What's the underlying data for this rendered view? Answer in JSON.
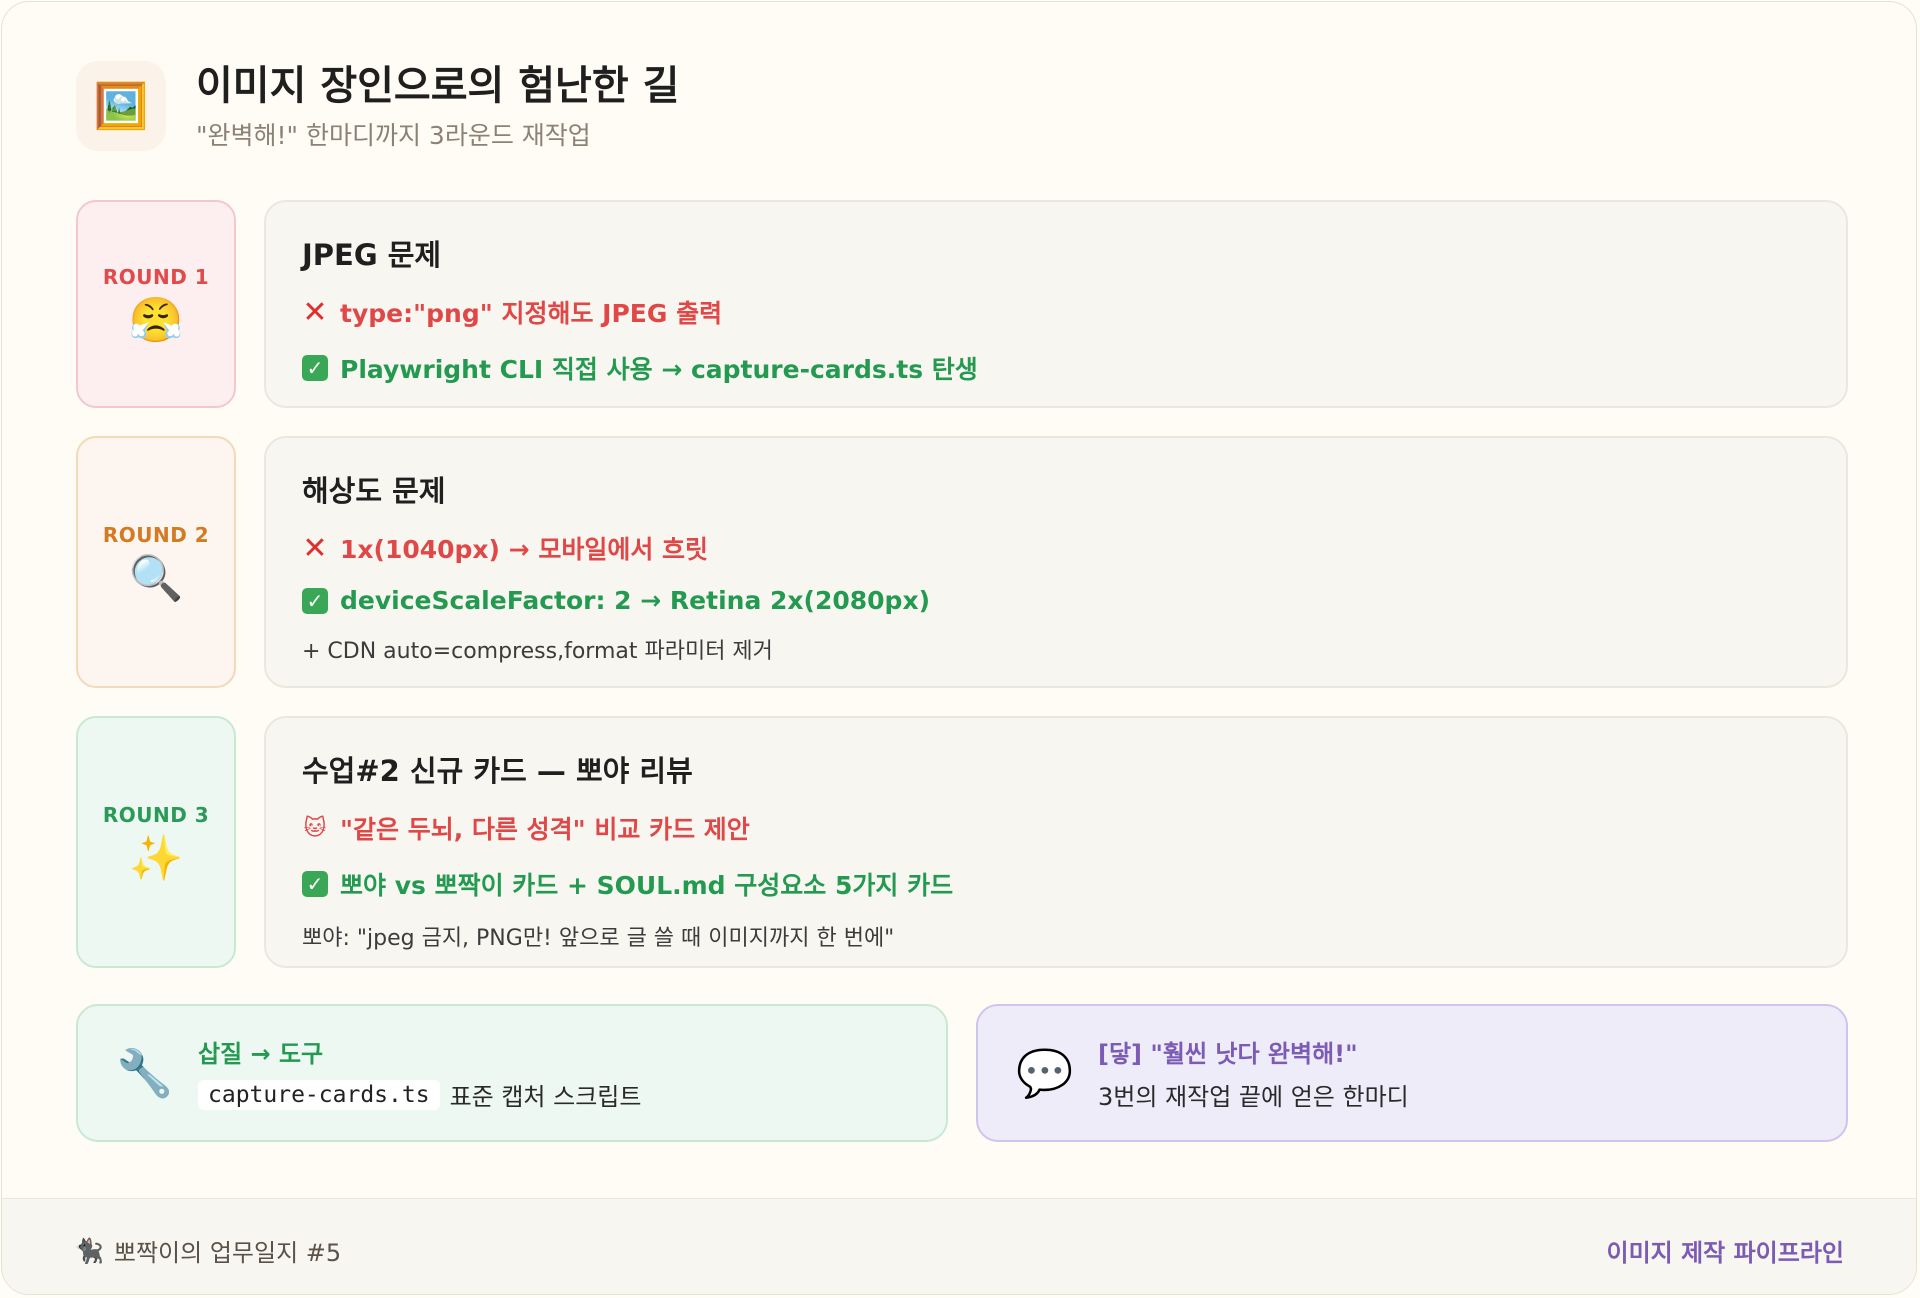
{
  "header": {
    "icon": "framed-picture-icon",
    "icon_glyph": "🖼️",
    "title": "이미지 장인으로의 험난한 길",
    "subtitle": "\"완벽해!\" 한마디까지 3라운드 재작업"
  },
  "rounds": [
    {
      "label": "ROUND 1",
      "label_color": "#e04a4a",
      "bg": "#fdeff0",
      "border": "#f3c7cc",
      "emoji": "😤",
      "emoji_name": "frustrated-face-icon",
      "title": "JPEG 문제",
      "fail": "type:\"png\" 지정해도 JPEG 출력",
      "fix": "Playwright CLI 직접 사용 → capture-cards.ts 탄생"
    },
    {
      "label": "ROUND 2",
      "label_color": "#d47a22",
      "bg": "#fdf6f0",
      "border": "#f2d9b8",
      "emoji": "🔍",
      "emoji_name": "magnifier-icon",
      "title": "해상도 문제",
      "fail": "1x(1040px) → 모바일에서 흐릿",
      "fix": "deviceScaleFactor: 2 → Retina 2x(2080px)",
      "note": "+ CDN auto=compress,format 파라미터 제거"
    },
    {
      "label": "ROUND 3",
      "label_color": "#2a9a57",
      "bg": "#eef8f2",
      "border": "#c7e9d3",
      "emoji": "✨",
      "emoji_name": "sparkles-icon",
      "title": "수업#2 신규 카드 — 뽀야 리뷰",
      "fail": "\"같은 두뇌, 다른 성격\" 비교 카드 제안",
      "fix": "뽀야 vs 뽀짝이 카드 + SOUL.md 구성요소 5가지 카드",
      "note": "뽀야: \"jpeg 금지, PNG만! 앞으로 글 쓸 때 이미지까지 한 번에\""
    }
  ],
  "bottom_left": {
    "icon": "wrench-icon",
    "title": "삽질 → 도구",
    "code": "capture-cards.ts",
    "text": "표준 캡처 스크립트"
  },
  "bottom_right": {
    "icon": "speech-bubble-icon",
    "title": "[닿] \"훨씬 낫다 완벽해!\"",
    "text": "3번의 재작업 끝에 얻은 한마디"
  },
  "footer": {
    "left": "뽀짝이의 업무일지 #5",
    "right": "이미지 제작 파이프라인"
  }
}
